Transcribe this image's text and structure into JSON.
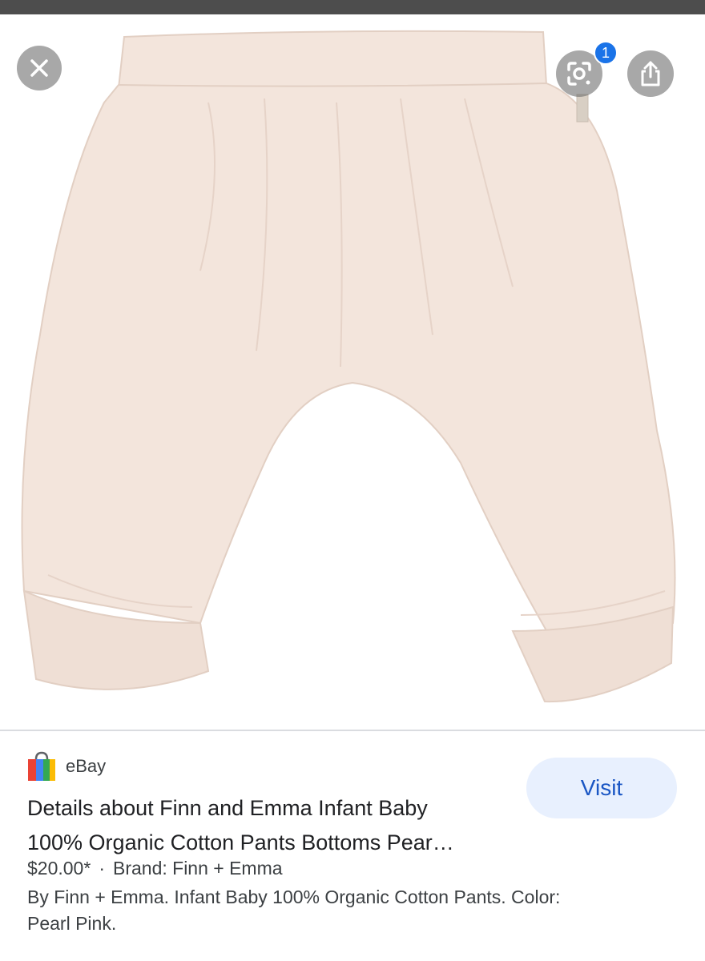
{
  "header": {
    "lens_badge_count": "1"
  },
  "icons": {
    "close": "close-icon",
    "lens": "google-lens-icon",
    "share": "share-icon",
    "source": "shopping-bag-icon"
  },
  "product": {
    "image_description_icon": "baby-pants-image",
    "colors": {
      "fabric": "#f3e5dc",
      "fabric_shadow": "#e6d3c8"
    }
  },
  "result": {
    "source_name": "eBay",
    "visit_label": "Visit",
    "title_line_1": "Details about Finn and Emma Infant Baby",
    "title_line_2": "100% Organic Cotton Pants Bottoms Pear…",
    "price": "$20.00*",
    "separator": "·",
    "brand": "Brand: Finn + Emma",
    "description_line_1": "By Finn + Emma. Infant Baby 100% Organic Cotton Pants. Color:",
    "description_line_2": "Pearl Pink."
  },
  "colors": {
    "accent": "#1a73e8",
    "visit_bg": "#e8f0fe",
    "visit_text": "#1a56c4"
  }
}
